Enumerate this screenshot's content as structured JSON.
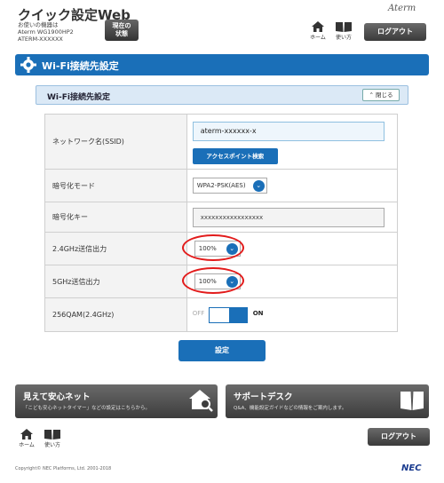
{
  "header": {
    "app_title": "クイック設定Web",
    "device_caption": "お使いの機器は",
    "device_model": "Aterm WG1900HP2",
    "device_ssid": "ATERM-XXXXXX",
    "status_line1": "現在の",
    "status_line2": "状態",
    "brand": "Aterm",
    "home_label": "ホーム",
    "manual_label": "使い方",
    "logout_label": "ログアウト"
  },
  "section": {
    "title": "Wi-Fi接続先設定"
  },
  "panel": {
    "title": "Wi-Fi接続先設定",
    "close_label": "閉じる"
  },
  "form": {
    "ssid_label": "ネットワーク名(SSID)",
    "ssid_value": "aterm-xxxxxx-x",
    "ap_search_label": "アクセスポイント検索",
    "enc_mode_label": "暗号化モード",
    "enc_mode_value": "WPA2-PSK(AES)",
    "enc_key_label": "暗号化キー",
    "enc_key_value": "xxxxxxxxxxxxxxxxx",
    "tx24_label": "2.4GHz送信出力",
    "tx24_value": "100%",
    "tx5_label": "5GHz送信出力",
    "tx5_value": "100%",
    "qam_label": "256QAM(2.4GHz)",
    "qam_off": "OFF",
    "qam_on": "ON",
    "submit_label": "設定"
  },
  "banners": {
    "safe_title": "見えて安心ネット",
    "safe_sub": "「こども安心ネットタイマー」などの設定はこちらから。",
    "support_title": "サポートデスク",
    "support_sub": "Q&A、機能設定ガイドなどの情報をご案内します。"
  },
  "footer": {
    "home_label": "ホーム",
    "manual_label": "使い方",
    "logout_label": "ログアウト",
    "copyright": "Copyright© NEC Platforms, Ltd. 2001-2018",
    "logo": "NEC"
  },
  "colors": {
    "primary": "#1a6fb8",
    "highlight_ring": "#e21b1b",
    "dark_button": "#3a3a3a"
  },
  "icons": [
    "gear-icon",
    "home-icon",
    "book-icon",
    "chevron-down-icon",
    "chevron-up-icon",
    "house-search-icon"
  ]
}
